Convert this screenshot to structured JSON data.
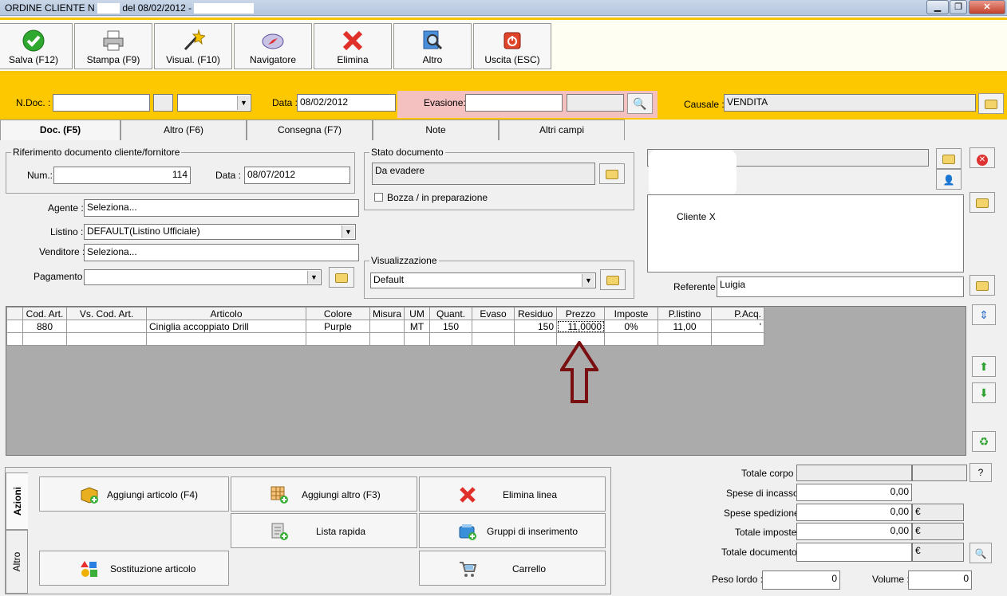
{
  "window": {
    "title": "ORDINE CLIENTE N",
    "title_rest": "del 08/02/2012 -",
    "min_label": "▁",
    "max_label": "❐",
    "close_label": "✕"
  },
  "toolbar": [
    {
      "label": "Salva (F12)"
    },
    {
      "label": "Stampa (F9)"
    },
    {
      "label": "Visual. (F10)"
    },
    {
      "label": "Navigatore"
    },
    {
      "label": "Elimina"
    },
    {
      "label": "Altro"
    },
    {
      "label": "Uscita (ESC)"
    }
  ],
  "header": {
    "ndoc_label": "N.Doc. :",
    "ndoc_value": "",
    "data_label": "Data :",
    "data_value": "08/02/2012",
    "evasione_label": "Evasione:",
    "evasione_value": "",
    "causale_label": "Causale :",
    "causale_value": "VENDITA"
  },
  "tabs": [
    "Doc. (F5)",
    "Altro (F6)",
    "Consegna (F7)",
    "Note",
    "Altri campi"
  ],
  "riferimento": {
    "legend": "Riferimento documento cliente/fornitore",
    "num_label": "Num.:",
    "num_value": "114",
    "data_label": "Data :",
    "data_value": "08/07/2012"
  },
  "fields": {
    "agente_label": "Agente :",
    "agente_value": "Seleziona...",
    "listino_label": "Listino :",
    "listino_value": "DEFAULT(Listino Ufficiale)",
    "venditore_label": "Venditore :",
    "venditore_value": "Seleziona...",
    "pagamento_label": "Pagamento :",
    "pagamento_value": ""
  },
  "stato": {
    "legend": "Stato documento",
    "value": "Da evadere",
    "bozza_label": "Bozza / in preparazione"
  },
  "visualizzazione": {
    "legend": "Visualizzazione",
    "value": "Default"
  },
  "cliente": {
    "name": "Cliente X",
    "referente_label": "Referente",
    "referente_value": "Luigia"
  },
  "grid": {
    "columns": [
      "",
      "Cod. Art.",
      "Vs. Cod. Art.",
      "Articolo",
      "Colore",
      "Misura",
      "UM",
      "Quant.",
      "Evaso",
      "Residuo",
      "Prezzo",
      "Imposte",
      "P.listino",
      "P.Acq."
    ],
    "rows": [
      [
        "",
        "880",
        "",
        "Ciniglia accoppiato Drill",
        "Purple",
        "",
        "MT",
        "150",
        "",
        "150",
        "11,0000",
        "0%",
        "11,00",
        "'"
      ],
      [
        "",
        "",
        "",
        "",
        "",
        "",
        "",
        "",
        "",
        "",
        "",
        "",
        "",
        ""
      ]
    ]
  },
  "actions": {
    "vtab_azioni": "Azioni",
    "vtab_altro": "Altro",
    "aggiungi_articolo": "Aggiungi articolo (F4)",
    "aggiungi_altro": "Aggiungi altro (F3)",
    "elimina_linea": "Elimina linea",
    "lista_rapida": "Lista rapida",
    "gruppi": "Gruppi di inserimento",
    "sostituzione": "Sostituzione articolo",
    "carrello": "Carrello"
  },
  "totals": {
    "totale_corpo_label": "Totale corpo :",
    "totale_corpo_value": "",
    "spese_incasso_label": "Spese di incasso :",
    "spese_incasso_value": "0,00",
    "spese_spedizione_label": "Spese spedizione :",
    "spese_spedizione_value": "0,00",
    "totale_imposte_label": "Totale imposte :",
    "totale_imposte_value": "0,00",
    "totale_documento_label": "Totale documento :",
    "totale_documento_value": "",
    "currency": "€",
    "peso_label": "Peso lordo :",
    "peso_value": "0",
    "volume_label": "Volume :",
    "volume_value": "0",
    "help_label": "?"
  },
  "colors": {
    "accent_yellow": "#fdc800",
    "arrow": "#7a0f12",
    "evasione_bg": "#f5c0c0"
  }
}
